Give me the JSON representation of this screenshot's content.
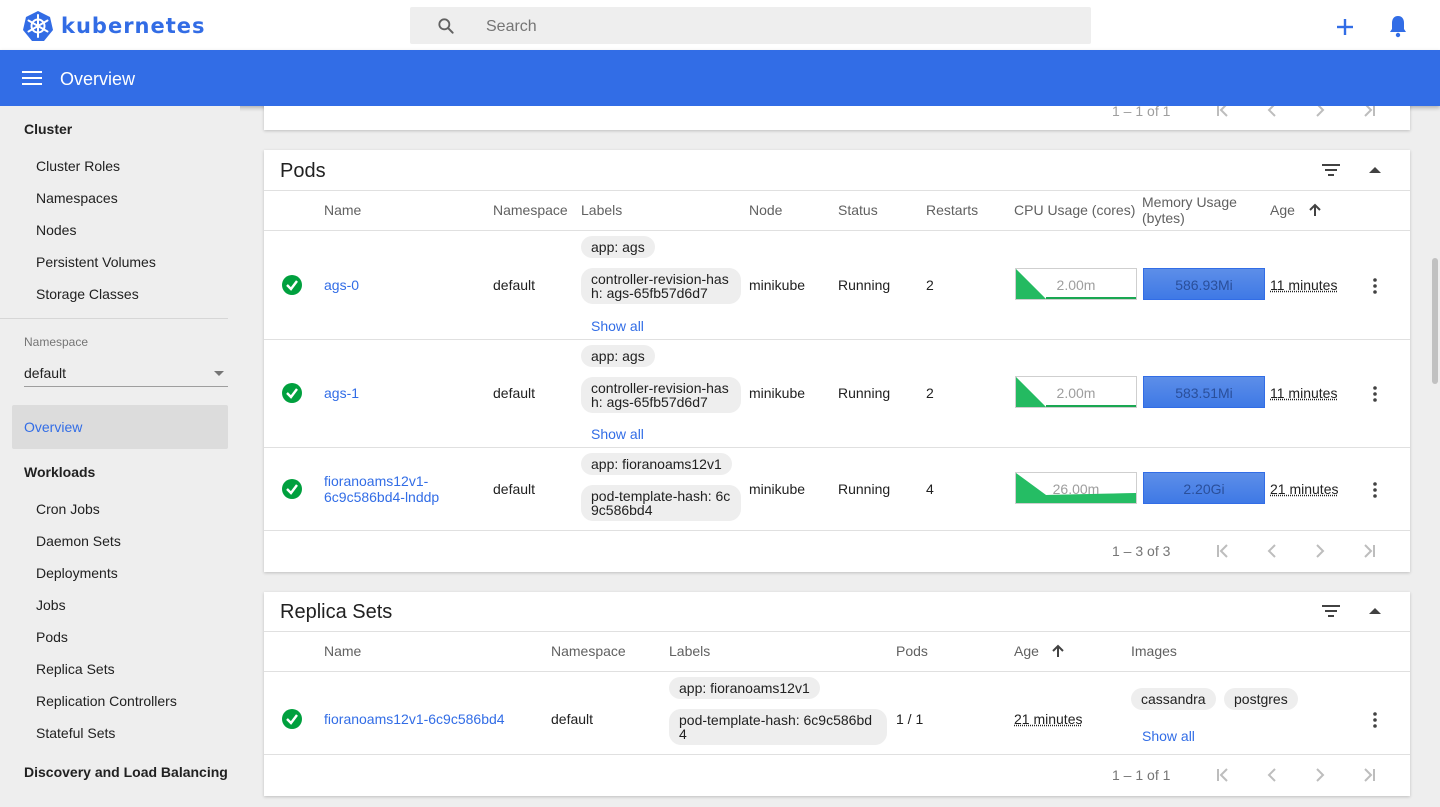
{
  "app": {
    "name": "kubernetes",
    "brand_color": "#326de6"
  },
  "search": {
    "placeholder": "Search"
  },
  "appbar": {
    "title": "Overview"
  },
  "sidebar": {
    "cluster_header": "Cluster",
    "cluster_items": [
      "Cluster Roles",
      "Namespaces",
      "Nodes",
      "Persistent Volumes",
      "Storage Classes"
    ],
    "namespace_label": "Namespace",
    "namespace_value": "default",
    "overview": "Overview",
    "workloads_header": "Workloads",
    "workload_items": [
      "Cron Jobs",
      "Daemon Sets",
      "Deployments",
      "Jobs",
      "Pods",
      "Replica Sets",
      "Replication Controllers",
      "Stateful Sets"
    ],
    "discovery_header": "Discovery and Load Balancing"
  },
  "top_card": {
    "pager": "1 – 1 of 1"
  },
  "pods": {
    "title": "Pods",
    "columns": [
      "Name",
      "Namespace",
      "Labels",
      "Node",
      "Status",
      "Restarts",
      "CPU Usage (cores)",
      "Memory Usage",
      "(bytes)",
      "Age"
    ],
    "rows": [
      {
        "name": "ags-0",
        "namespace": "default",
        "labels": [
          "app: ags",
          "controller-revision-hash: ags-65fb57d6d7"
        ],
        "show_all": "Show all",
        "node": "minikube",
        "status": "Running",
        "restarts": "2",
        "cpu": "2.00m",
        "memory": "586.93Mi",
        "age": "11 minutes"
      },
      {
        "name": "ags-1",
        "namespace": "default",
        "labels": [
          "app: ags",
          "controller-revision-hash: ags-65fb57d6d7"
        ],
        "show_all": "Show all",
        "node": "minikube",
        "status": "Running",
        "restarts": "2",
        "cpu": "2.00m",
        "memory": "583.51Mi",
        "age": "11 minutes"
      },
      {
        "name_line1": "fioranoams12v1-",
        "name_line2": "6c9c586bd4-lnddp",
        "namespace": "default",
        "labels": [
          "app: fioranoams12v1",
          "pod-template-hash: 6c9c586bd4"
        ],
        "node": "minikube",
        "status": "Running",
        "restarts": "4",
        "cpu": "26.00m",
        "memory": "2.20Gi",
        "age": "21 minutes"
      }
    ],
    "pager": "1 – 3 of 3"
  },
  "replica_sets": {
    "title": "Replica Sets",
    "columns": [
      "Name",
      "Namespace",
      "Labels",
      "Pods",
      "Age",
      "Images"
    ],
    "rows": [
      {
        "name": "fioranoams12v1-6c9c586bd4",
        "namespace": "default",
        "labels": [
          "app: fioranoams12v1",
          "pod-template-hash: 6c9c586bd4"
        ],
        "pods": "1 / 1",
        "age": "21 minutes",
        "images": [
          "cassandra",
          "postgres"
        ],
        "show_all": "Show all"
      }
    ],
    "pager": "1 – 1 of 1"
  }
}
